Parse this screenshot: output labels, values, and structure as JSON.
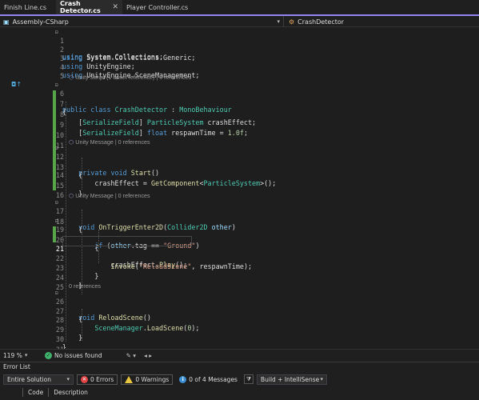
{
  "tabs": [
    {
      "label": "Finish Line.cs",
      "active": false
    },
    {
      "label": "Crash Detector.cs",
      "active": true
    },
    {
      "label": "Player Controller.cs",
      "active": false
    }
  ],
  "navbar": {
    "project": "Assembly-CSharp",
    "class": "CrashDetector"
  },
  "editor": {
    "hints": {
      "class_hint": "Unity Script (1 asset reference) | 0 references",
      "start_hint": "Unity Message | 0 references",
      "trigger_hint": "Unity Message | 0 references",
      "reload_hint": "0 references"
    },
    "lines": [
      {
        "n": "1",
        "text": "using System.Collections;"
      },
      {
        "n": "2",
        "text": "using System.Collections.Generic;"
      },
      {
        "n": "3",
        "text": "using UnityEngine;"
      },
      {
        "n": "4",
        "text": "using UnityEngine.SceneManagement;"
      },
      {
        "n": "5",
        "text": ""
      },
      {
        "n": "6",
        "text": "public class CrashDetector : MonoBehaviour"
      },
      {
        "n": "7",
        "text": "{"
      },
      {
        "n": "8",
        "text": "    [SerializeField] ParticleSystem crashEffect;"
      },
      {
        "n": "9",
        "text": "    [SerializeField] float respawnTime = 1.0f;"
      },
      {
        "n": "10",
        "text": ""
      },
      {
        "n": "11",
        "text": ""
      },
      {
        "n": "12",
        "text": "    private void Start()"
      },
      {
        "n": "13",
        "text": "    {"
      },
      {
        "n": "14",
        "text": "        crashEffect = GetComponent<ParticleSystem>();"
      },
      {
        "n": "15",
        "text": "    }"
      },
      {
        "n": "16",
        "text": ""
      },
      {
        "n": "17",
        "text": "    void OnTriggerEnter2D(Collider2D other)"
      },
      {
        "n": "18",
        "text": "    {"
      },
      {
        "n": "19",
        "text": "        if (other.tag == \"Ground\")"
      },
      {
        "n": "20",
        "text": "        {"
      },
      {
        "n": "21",
        "text": "            crashEffect.Play();"
      },
      {
        "n": "22",
        "text": "            Invoke(\"ReloadScene\", respawnTime);"
      },
      {
        "n": "23",
        "text": "        }"
      },
      {
        "n": "24",
        "text": "    }"
      },
      {
        "n": "25",
        "text": ""
      },
      {
        "n": "26",
        "text": "    void ReloadScene()"
      },
      {
        "n": "27",
        "text": "    {"
      },
      {
        "n": "28",
        "text": "        SceneManager.LoadScene(0);"
      },
      {
        "n": "29",
        "text": "    }"
      },
      {
        "n": "30",
        "text": "}"
      },
      {
        "n": "31",
        "text": ""
      }
    ],
    "current_line": "21"
  },
  "status": {
    "zoom": "119 %",
    "issues": "No issues found"
  },
  "error_list": {
    "title": "Error List",
    "scope": "Entire Solution",
    "errors": "0 Errors",
    "warnings": "0 Warnings",
    "messages": "0 of 4 Messages",
    "build": "Build + IntelliSense",
    "columns": [
      "Code",
      "Description"
    ]
  },
  "colors": {
    "accent": "#9184ee",
    "change_bar": "#57a64a",
    "keyword": "#569cd6",
    "type": "#4ec9b0",
    "string": "#d69d85",
    "method": "#dcdcaa"
  }
}
